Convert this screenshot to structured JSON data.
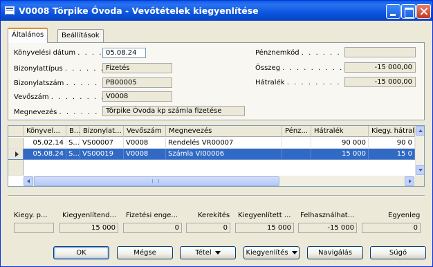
{
  "window": {
    "title": "V0008 Törpike Óvoda - Vevőtételek kiegyenlítése"
  },
  "tabs": [
    "Általános",
    "Beállítások"
  ],
  "general": {
    "posting_date": {
      "label": "Könyvelési dátum",
      "value": "05.08.24"
    },
    "document_type": {
      "label": "Bizonylattípus",
      "value": "Fizetés"
    },
    "document_no": {
      "label": "Bizonylatszám",
      "value": "PB00005"
    },
    "customer_no": {
      "label": "Vevőszám",
      "value": "V0008"
    },
    "description": {
      "label": "Megnevezés",
      "value": "Törpike Óvoda kp számla fizetése"
    },
    "currency_code": {
      "label": "Pénznemkód",
      "value": ""
    },
    "amount": {
      "label": "Összeg",
      "value": "-15 000,00"
    },
    "remaining": {
      "label": "Hátralék",
      "value": "-15 000,00"
    }
  },
  "table": {
    "columns": [
      "Könyvel...",
      "B...",
      "Bizonylat...",
      "Vevőszám",
      "Megnevezés",
      "Pénz...",
      "Hátralék",
      "Kiegy. hátral"
    ],
    "rows": [
      {
        "date": "05.02.14",
        "type": "S...",
        "doc": "VS00007",
        "cust": "V0008",
        "desc": "Rendelés VR00007",
        "cur": "",
        "remaining": "90 000",
        "remaining_to_apply": "90 0"
      },
      {
        "date": "05.08.24",
        "type": "S...",
        "doc": "VS00019",
        "cust": "V0008",
        "desc": "Számla VI00006",
        "cur": "",
        "remaining": "15 000",
        "remaining_to_apply": "15 0"
      }
    ],
    "selected_row": 1
  },
  "totals": {
    "labels": [
      "Kiegy. p...",
      "Kiegyenlítend...",
      "Fizetési enge...",
      "Kerekítés",
      "Kiegyenlített ...",
      "Felhasználhat...",
      "Egyenleg"
    ],
    "values": [
      "",
      "15 000",
      "0",
      "0",
      "15 000",
      "-15 000",
      "0"
    ]
  },
  "buttons": {
    "ok": "OK",
    "cancel": "Mégse",
    "entry": "Tétel",
    "apply": "Kiegyenlítés",
    "navigate": "Navigálás",
    "help": "Súgó"
  },
  "colors": {
    "titlebar": "#0a5fe8",
    "selection": "#316ac5",
    "tab_accent": "#e68b2c"
  }
}
